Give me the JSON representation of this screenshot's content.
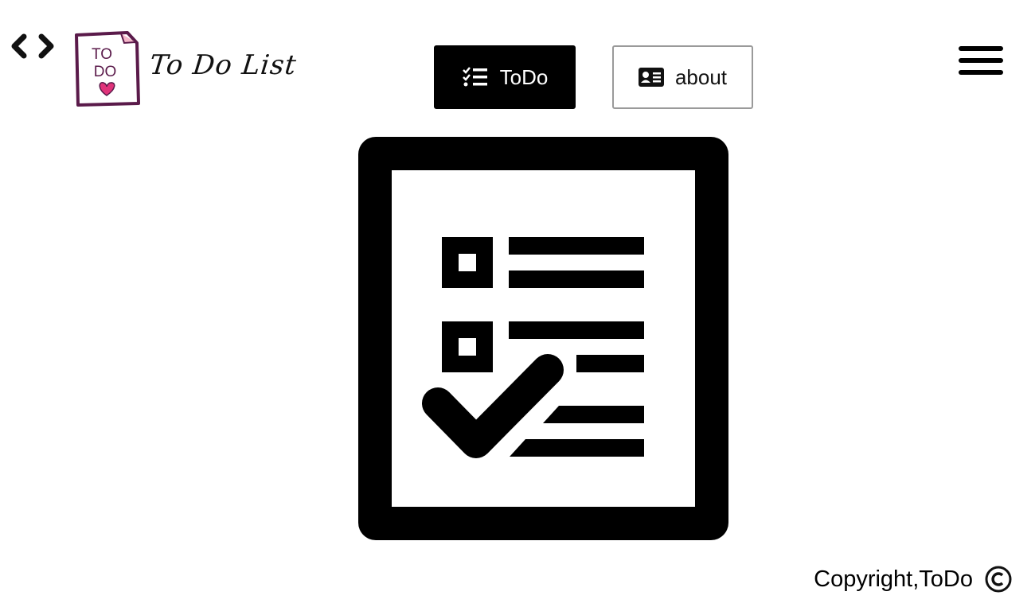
{
  "header": {
    "logo": {
      "badge_line1": "TO",
      "badge_line2": "DO",
      "title": "To Do List"
    },
    "icons": {
      "code": "code-icon",
      "menu": "hamburger-menu-icon"
    }
  },
  "nav": {
    "todo": {
      "label": "ToDo",
      "icon": "list-check-icon"
    },
    "about": {
      "label": "about",
      "icon": "id-card-icon"
    }
  },
  "hero": {
    "icon": "checklist-icon"
  },
  "footer": {
    "copyright": "Copyright,ToDo",
    "icon": "copyright-icon"
  },
  "colors": {
    "primary": "#000000",
    "accent": "#e0337a",
    "logo_frame": "#5a1a4a",
    "outline": "#9a9a9a"
  }
}
